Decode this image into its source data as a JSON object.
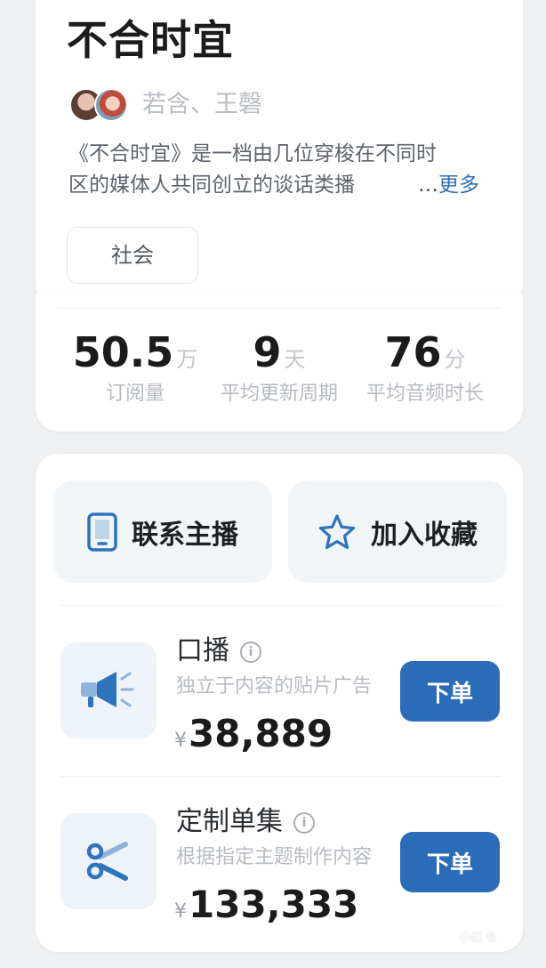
{
  "podcast": {
    "title": "不合时宜",
    "authors": "若含、王磬",
    "description_lines": [
      "《不合时宜》是一档由几位穿梭在不同时",
      "区的媒体人共同创立的谈话类播"
    ],
    "more_ellipsis": "…",
    "more_label": "更多",
    "tag": "社会"
  },
  "stats": [
    {
      "value": "50.5",
      "unit": "万",
      "label": "订阅量"
    },
    {
      "value": "9",
      "unit": "天",
      "label": "平均更新周期"
    },
    {
      "value": "76",
      "unit": "分",
      "label": "平均音频时长"
    }
  ],
  "actions": {
    "contact_label": "联系主播",
    "contact_icon": "phone-icon",
    "favorite_label": "加入收藏",
    "favorite_icon": "star-icon"
  },
  "services": [
    {
      "title": "口播",
      "subtitle": "独立于内容的贴片广告",
      "currency": "¥",
      "price": "38,889",
      "button": "下单",
      "icon": "megaphone-icon"
    },
    {
      "title": "定制单集",
      "subtitle": "根据指定主题制作内容",
      "currency": "¥",
      "price": "133,333",
      "button": "下单",
      "icon": "scissors-icon"
    }
  ],
  "info_glyph": "i",
  "watermark": "小红书",
  "colors": {
    "accent": "#2b6cb8",
    "icon_blue": "#2d74bd",
    "icon_bg": "#edf3f9",
    "page_bg": "#eef0f2"
  }
}
